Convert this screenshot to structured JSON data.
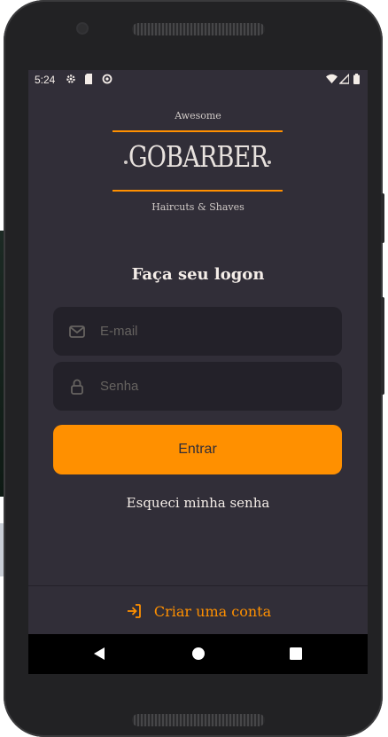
{
  "status_bar": {
    "time": "5:24",
    "left_icons": [
      "gear-icon",
      "sd-card-icon",
      "sync-icon"
    ],
    "right_icons": [
      "wifi-icon",
      "cellular-icon",
      "battery-icon"
    ]
  },
  "logo": {
    "top_text": "Awesome",
    "brand": "GOBARBER",
    "bottom_text": "Haircuts & Shaves",
    "accent_color": "#ff9000"
  },
  "form": {
    "title": "Faça seu logon",
    "email_placeholder": "E-mail",
    "password_placeholder": "Senha",
    "submit_label": "Entrar",
    "forgot_label": "Esqueci minha senha"
  },
  "footer": {
    "create_account_label": "Criar uma conta"
  },
  "navigation": {
    "buttons": [
      "back-icon",
      "home-icon",
      "recents-icon"
    ]
  },
  "colors": {
    "background": "#312e38",
    "input_background": "#232129",
    "primary": "#ff9000",
    "text": "#f4ede8",
    "placeholder": "#666360"
  }
}
